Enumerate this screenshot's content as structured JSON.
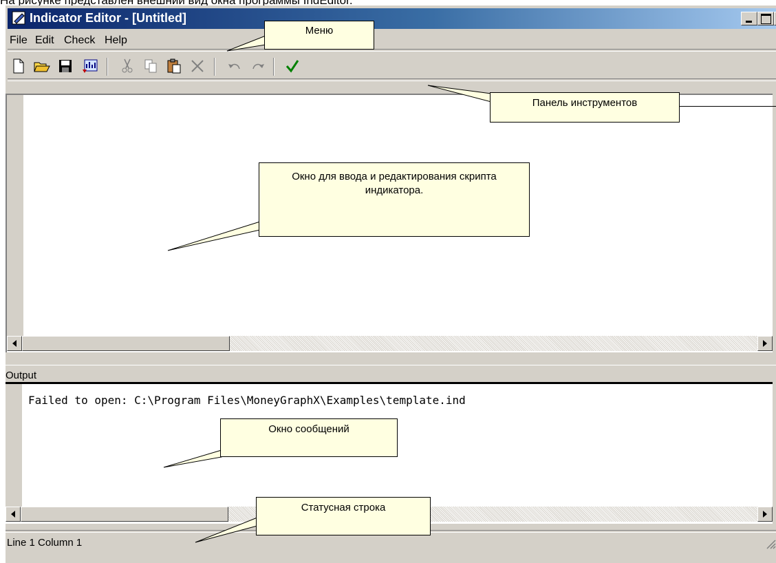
{
  "caption": "На рисунке представлен внешний вид окна программы IndEditor.",
  "window": {
    "title": "Indicator Editor - [Untitled]"
  },
  "menu": {
    "items": [
      "File",
      "Edit",
      "Check",
      "Help"
    ]
  },
  "toolbar": {
    "buttons": [
      "new-file-icon",
      "open-folder-icon",
      "save-icon",
      "chart-export-icon",
      "cut-icon",
      "copy-icon",
      "paste-icon",
      "delete-icon",
      "undo-icon",
      "redo-icon",
      "check-icon"
    ]
  },
  "output": {
    "label": "Output",
    "message": "Failed to open: C:\\Program Files\\MoneyGraphX\\Examples\\template.ind"
  },
  "status": {
    "text": "Line 1  Column 1"
  },
  "callouts": {
    "menu": "Меню",
    "toolbar": "Панель инструментов",
    "editor": "Окно для ввода и редактирования скрипта индикатора.",
    "messages": "Окно сообщений",
    "statusbar": "Статусная строка"
  },
  "colors": {
    "title_start": "#0a246a",
    "title_end": "#a6caf0",
    "callout_bg": "#ffffe1",
    "check_green": "#008000"
  }
}
